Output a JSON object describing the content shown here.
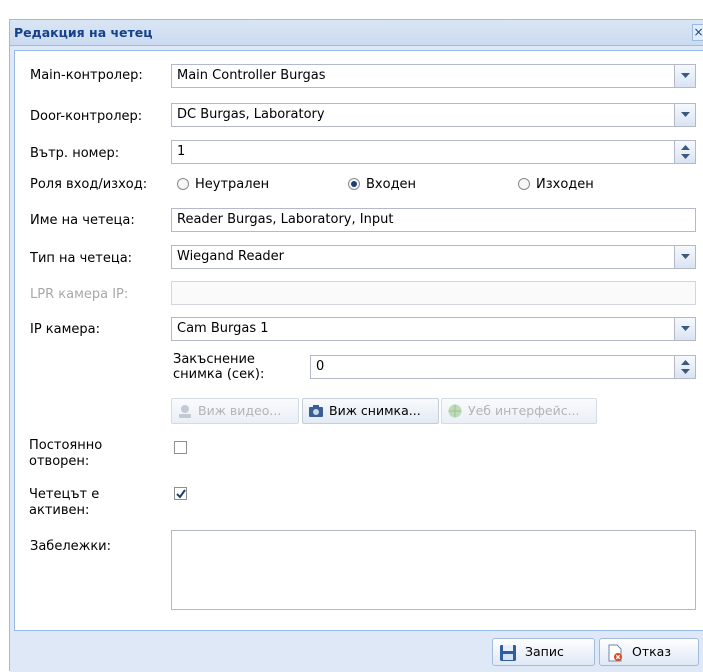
{
  "dialog": {
    "title": "Редакция на четец",
    "close_icon": "×"
  },
  "form": {
    "main_controller": {
      "label": "Main-контролер:",
      "value": "Main Controller Burgas"
    },
    "door_controller": {
      "label": "Door-контролер:",
      "value": "DC Burgas, Laboratory"
    },
    "internal_number": {
      "label": "Вътр. номер:",
      "value": "1"
    },
    "role": {
      "label": "Роля вход/изход:",
      "options": [
        "Неутрален",
        "Входен",
        "Изходен"
      ],
      "selected": "Входен"
    },
    "reader_name": {
      "label": "Име на четеца:",
      "value": "Reader Burgas, Laboratory, Input"
    },
    "reader_type": {
      "label": "Тип на четеца:",
      "value": "Wiegand Reader"
    },
    "lpr_camera_ip": {
      "label": "LPR камера IP:",
      "value": ""
    },
    "ip_camera": {
      "label": "IP камера:",
      "value": "Cam Burgas 1"
    },
    "snapshot_delay": {
      "label_line1": "Закъснение",
      "label_line2": "снимка (сек):",
      "value": "0"
    },
    "camera_buttons": {
      "view_video": "Виж видео...",
      "view_snapshot": "Виж снимка...",
      "web_interface": "Уеб интерфейс..."
    },
    "always_open": {
      "label_line1": "Постоянно",
      "label_line2": "отворен:",
      "checked": false
    },
    "reader_active": {
      "label_line1": "Четецът е",
      "label_line2": "активен:",
      "checked": true
    },
    "notes": {
      "label": "Забележки:",
      "value": ""
    }
  },
  "footer": {
    "save_label": "Запис",
    "cancel_label": "Отказ"
  },
  "colors": {
    "title_text": "#15428b",
    "window_bg": "#dfe8f6",
    "border": "#99bbe8"
  }
}
